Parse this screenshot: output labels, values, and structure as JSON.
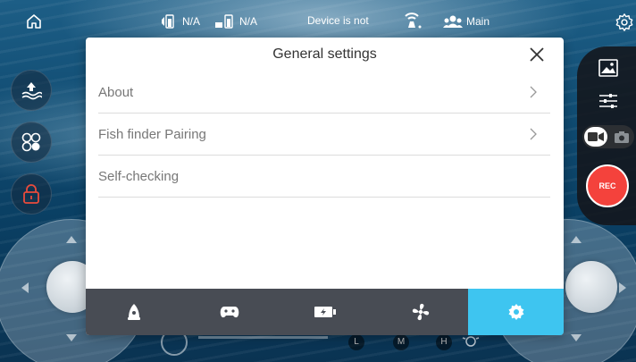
{
  "status_bar": {
    "battery1": "N/A",
    "battery2": "N/A",
    "device_status": "Device is not",
    "mode": "Main"
  },
  "modal": {
    "title": "General settings",
    "items": [
      {
        "label": "About",
        "has_chevron": true
      },
      {
        "label": "Fish finder Pairing",
        "has_chevron": true
      },
      {
        "label": "Self-checking",
        "has_chevron": false
      }
    ],
    "tabs": [
      {
        "icon": "rov-icon",
        "active": false
      },
      {
        "icon": "gamepad-icon",
        "active": false
      },
      {
        "icon": "battery-charging-icon",
        "active": false
      },
      {
        "icon": "fan-icon",
        "active": false
      },
      {
        "icon": "gear-icon",
        "active": true
      }
    ]
  },
  "right_panel": {
    "rec_label": "REC"
  },
  "colors": {
    "accent": "#3ec5f0",
    "tabbar": "#484c54",
    "rec": "#f4423c",
    "lock": "#e94b3c"
  },
  "light_levels": [
    "L",
    "M",
    "H"
  ]
}
